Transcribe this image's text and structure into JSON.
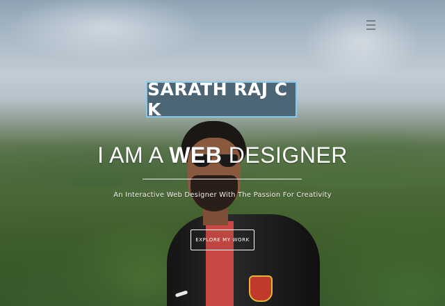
{
  "header": {
    "menu_icon": "hamburger-menu-icon"
  },
  "hero": {
    "name": "SARATH RAJ C K",
    "headline_prefix": "I AM A",
    "headline_emphasis": "WEB",
    "headline_suffix": "DESIGNER",
    "tagline": "An Interactive Web Designer With The Passion For Creativity",
    "cta_label": "EXPLORE MY WORK"
  },
  "colors": {
    "name_box_bg": "#4c6676",
    "name_box_border": "#89c8e8",
    "text": "#ffffff"
  }
}
